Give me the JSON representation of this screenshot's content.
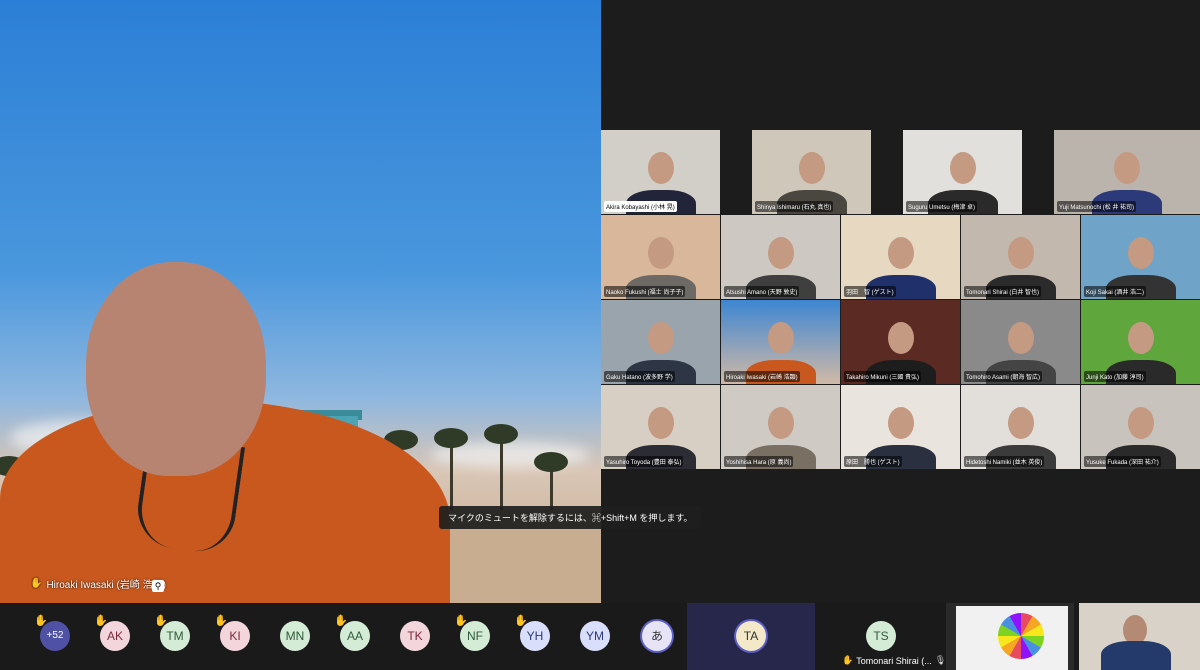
{
  "speaker": {
    "name": "Hiroaki Iwasaki (岩崎 浩顕)"
  },
  "notification": {
    "text": "マイクのミュートを解除するには、⌘+Shift+M を押します。"
  },
  "gallery": [
    {
      "name": "Akira Kobayashi (小林 晃)"
    },
    {
      "name": "Shinya Ishimaru (石丸 真也)"
    },
    {
      "name": "Suguru Umetsu (梅津 卓)"
    },
    {
      "name": "Yuji Matsunochi (松 井 祐司)"
    },
    {
      "name": "Naoko Fukushi (福士 尚子子)"
    },
    {
      "name": "Atsushi Amano (天野 敦史)"
    },
    {
      "name": "羽田　智 (ゲスト)"
    },
    {
      "name": "Tomonari Shirai (白井 智也)"
    },
    {
      "name": "Koji Sakai (酒井 浩二)"
    },
    {
      "name": "Gaku Hatano (波多野 学)"
    },
    {
      "name": "Hiroaki Iwasaki (岩崎 浩顕)"
    },
    {
      "name": "Takahiro Mikuni (三國 貴弘)"
    },
    {
      "name": "Tomohiro Asami (朝海 智広)"
    },
    {
      "name": "Junji Kato (加藤 淳司)"
    },
    {
      "name": "Yasuhiro Toyoda (豊田 泰弘)"
    },
    {
      "name": "Yoshihisa Hara (原 義尚)"
    },
    {
      "name": "原田　勝也 (ゲスト)"
    },
    {
      "name": "Hidetoshi Namiki (並木 英俊)"
    },
    {
      "name": "Yusuke Fukada (深田 祐介)"
    }
  ],
  "strip": {
    "more_count": "+52",
    "avatars": [
      "AK",
      "TM",
      "KI",
      "MN",
      "AA",
      "TK",
      "NF",
      "YH",
      "YM",
      "あ"
    ],
    "ta": "TA",
    "ts": "TS",
    "ts_name": "Tomonari Shirai (..."
  },
  "colors": {
    "accent": "#5b5fc7",
    "hand": "#f4c430"
  },
  "icons": {
    "hand": "raised-hand-icon",
    "mic_off": "mic-off-icon",
    "pin": "pin-icon"
  }
}
